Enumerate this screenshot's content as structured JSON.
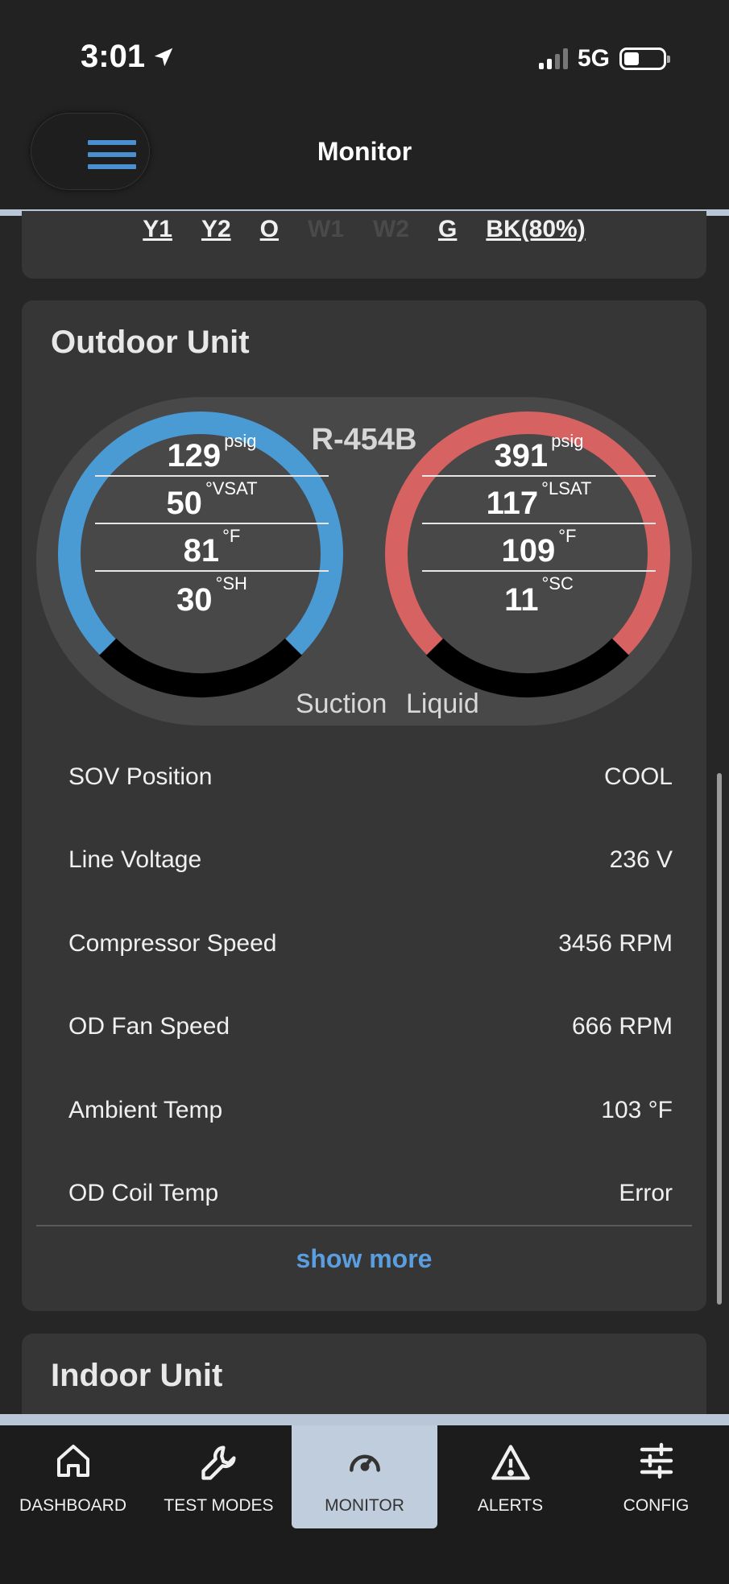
{
  "status_bar": {
    "time": "3:01",
    "network": "5G"
  },
  "header": {
    "title": "Monitor"
  },
  "thermostat_calls": [
    {
      "label": "Y1",
      "active": true
    },
    {
      "label": "Y2",
      "active": true
    },
    {
      "label": "O",
      "active": true
    },
    {
      "label": "W1",
      "active": false
    },
    {
      "label": "W2",
      "active": false
    },
    {
      "label": "G",
      "active": true
    },
    {
      "label": "BK(80%)",
      "active": true
    }
  ],
  "outdoor": {
    "title": "Outdoor Unit",
    "refrigerant": "R-454B",
    "suction": {
      "label": "Suction",
      "color": "#4a9ad4",
      "rows": [
        {
          "value": "129",
          "unit": "psig"
        },
        {
          "value": "50",
          "unit": "°VSAT"
        },
        {
          "value": "81",
          "unit": "°F"
        },
        {
          "value": "30",
          "unit": "°SH"
        }
      ]
    },
    "liquid": {
      "label": "Liquid",
      "color": "#d66262",
      "rows": [
        {
          "value": "391",
          "unit": "psig"
        },
        {
          "value": "117",
          "unit": "°LSAT"
        },
        {
          "value": "109",
          "unit": "°F"
        },
        {
          "value": "11",
          "unit": "°SC"
        }
      ]
    },
    "details": [
      {
        "label": "SOV Position",
        "value": "COOL"
      },
      {
        "label": "Line Voltage",
        "value": "236 V"
      },
      {
        "label": "Compressor Speed",
        "value": "3456 RPM"
      },
      {
        "label": "OD Fan Speed",
        "value": "666 RPM"
      },
      {
        "label": "Ambient Temp",
        "value": "103 °F"
      },
      {
        "label": "OD Coil Temp",
        "value": "Error"
      }
    ],
    "show_more": "show more"
  },
  "indoor": {
    "title": "Indoor Unit"
  },
  "nav": {
    "items": [
      {
        "label": "DASHBOARD",
        "icon": "home-icon"
      },
      {
        "label": "TEST MODES",
        "icon": "wrench-icon"
      },
      {
        "label": "MONITOR",
        "icon": "gauge-icon",
        "active": true
      },
      {
        "label": "ALERTS",
        "icon": "warning-icon"
      },
      {
        "label": "CONFIG",
        "icon": "sliders-icon"
      }
    ]
  },
  "colors": {
    "accent": "#5a9ee0",
    "nav_active_bg": "#c0cddd"
  }
}
